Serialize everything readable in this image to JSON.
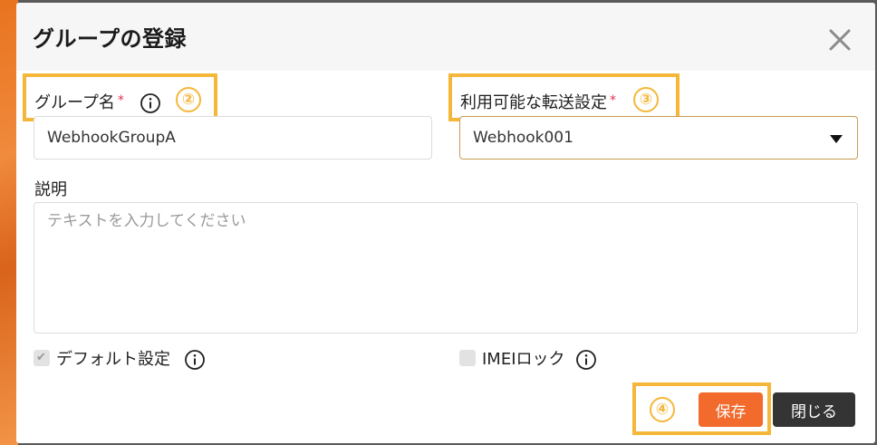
{
  "dialog": {
    "title": "グループの登録"
  },
  "group_name": {
    "label": "グループ名",
    "required_mark": "*",
    "value": "WebhookGroupA",
    "marker": "②"
  },
  "forwarding": {
    "label": "利用可能な転送設定",
    "required_mark": "*",
    "value": "Webhook001",
    "marker": "③"
  },
  "description": {
    "label": "説明",
    "placeholder": "テキストを入力してください"
  },
  "options": {
    "default_label": "デフォルト設定",
    "default_checked": true,
    "imei_label": "IMEIロック",
    "imei_checked": false
  },
  "footer": {
    "marker": "④",
    "save_label": "保存",
    "close_label": "閉じる"
  },
  "colors": {
    "accent": "#f26a2c",
    "marker": "#f5b73a",
    "required": "#e0314b",
    "dark_button": "#343434"
  }
}
